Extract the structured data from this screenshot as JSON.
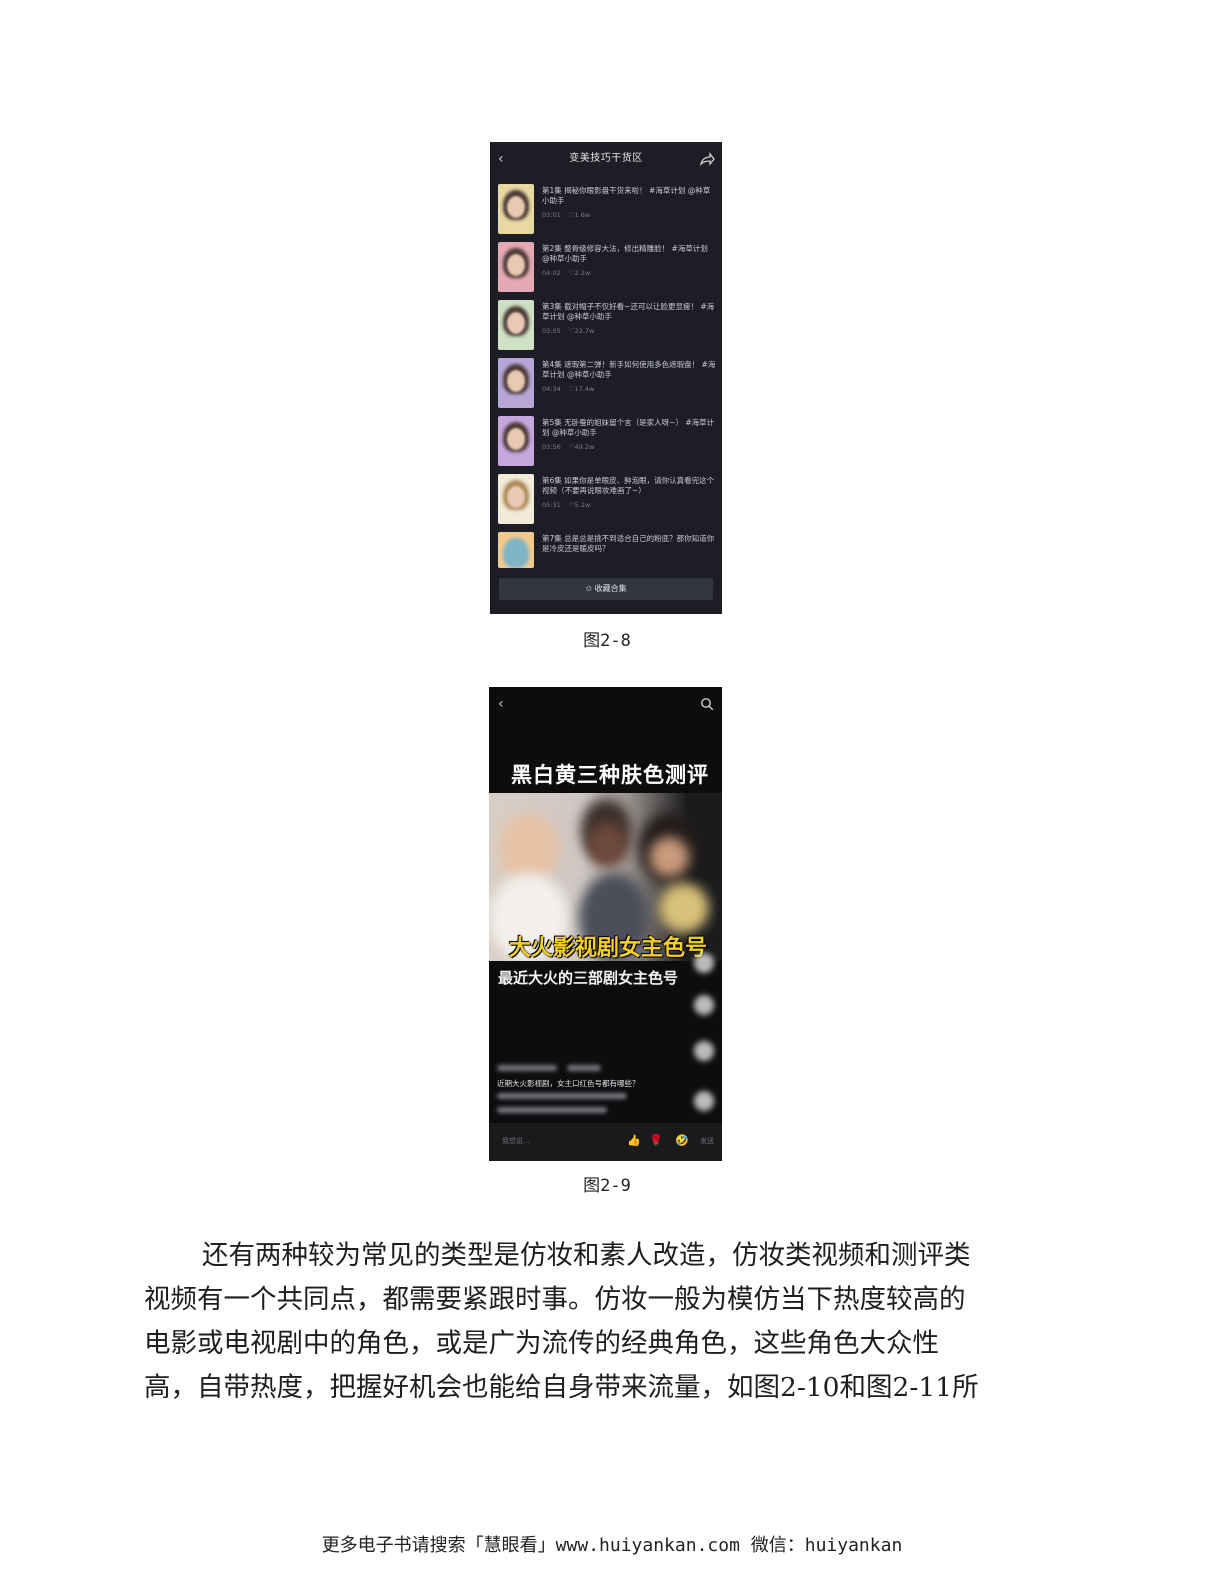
{
  "figure_2_8": {
    "screen_title": "变美技巧干货区",
    "episodes": [
      {
        "text": "第1集  揭秘你眼影盘干货来啦！ #海草计划 @种草小助手",
        "duration": "03:01",
        "likes": "♡1.6w"
      },
      {
        "text": "第2集  整骨级修容大法，修出精雕脸！ #海草计划 @种草小助手",
        "duration": "04:02",
        "likes": "♡2.2w"
      },
      {
        "text": "第3集  截对帽子不仅好看~还可以让脸更显瘦！ #海草计划 @种草小助手",
        "duration": "03:05",
        "likes": "♡22.7w"
      },
      {
        "text": "第4集  遮瑕第二弹！新手如何使用多色遮瑕盘！ #海草计划 @种草小助手",
        "duration": "04:34",
        "likes": "♡17.4w"
      },
      {
        "text": "第5集  无卧蚕的姐妹留个言（是家人呀~） #海草计划 @种草小助手",
        "duration": "03:56",
        "likes": "♡49.2w"
      },
      {
        "text": "第6集  如果你是单眼皮、肿泡眼，请你认真看完这个视频（不要再说眼妆难画了~）",
        "duration": "05:31",
        "likes": "♡5.2w"
      },
      {
        "text": "第7集  总是总是挑不到适合自己的粉底？那你知道你是冷皮还是暖皮吗？",
        "duration": "",
        "likes": ""
      }
    ],
    "collect_button": "✩ 收藏合集",
    "caption": "图2-8"
  },
  "figure_2_9": {
    "overlay_title": "黑白黄三种肤色测评",
    "overlay_yellow": "大火影视剧女主色号",
    "overlay_sub": "最近大火的三部剧女主色号",
    "description": "近期大火影视剧，女主口红色号都有哪些？",
    "comment_placeholder": "我想说...",
    "send_label": "发送",
    "emojis": [
      "👍",
      "🌹",
      "🤣"
    ],
    "caption": "图2-9"
  },
  "body_text": [
    "还有两种较为常见的类型是仿妆和素人改造，仿妆类视频和测评类",
    "视频有一个共同点，都需要紧跟时事。仿妆一般为模仿当下热度较高的",
    "电影或电视剧中的角色，或是广为流传的经典角色，这些角色大众性",
    "高，自带热度，把握好机会也能给自身带来流量，如图2-10和图2-11所"
  ],
  "footer": "更多电子书请搜索「慧眼看」www.huiyankan.com  微信：huiyankan"
}
